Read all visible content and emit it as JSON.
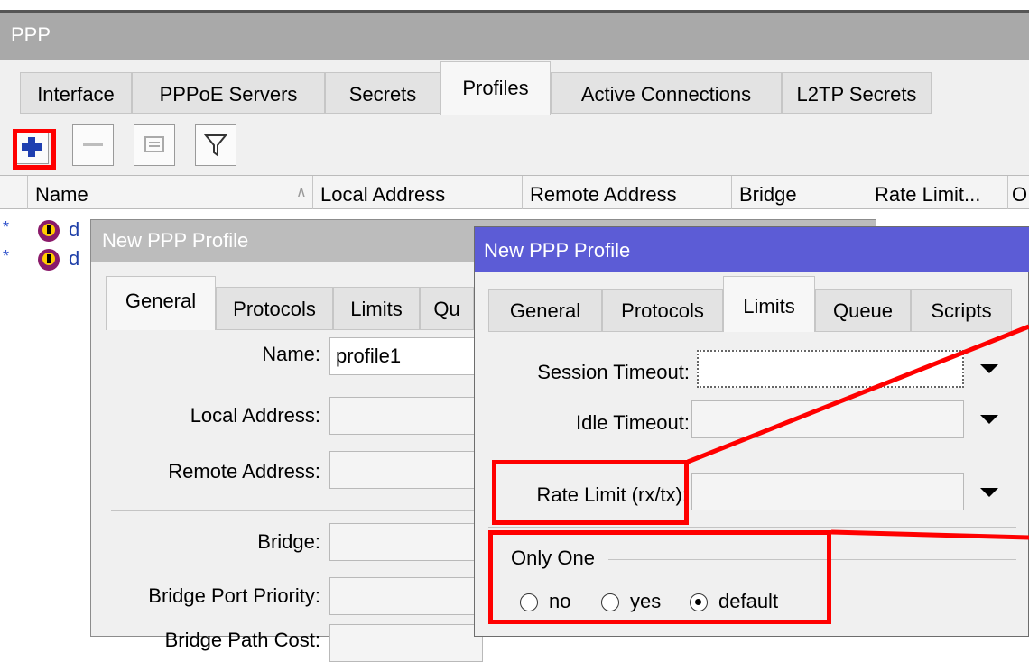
{
  "window": {
    "title": "PPP"
  },
  "main_tabs": [
    {
      "label": "Interface"
    },
    {
      "label": "PPPoE Servers"
    },
    {
      "label": "Secrets"
    },
    {
      "label": "Profiles"
    },
    {
      "label": "Active Connections"
    },
    {
      "label": "L2TP Secrets"
    }
  ],
  "active_main_tab": "Profiles",
  "toolbar": [
    "add-icon",
    "remove-icon",
    "comment-icon",
    "filter-icon"
  ],
  "table": {
    "columns": [
      "Name",
      "Local Address",
      "Remote Address",
      "Bridge",
      "Rate Limit...",
      "O"
    ],
    "rows": [
      {
        "marker": "*",
        "name": "d"
      },
      {
        "marker": "*",
        "name": "d"
      }
    ]
  },
  "dialog_general": {
    "title": "New PPP Profile",
    "tabs": [
      "General",
      "Protocols",
      "Limits",
      "Qu"
    ],
    "active_tab": "General",
    "fields": {
      "name_label": "Name:",
      "name_value": "profile1",
      "local_address_label": "Local Address:",
      "remote_address_label": "Remote Address:",
      "bridge_label": "Bridge:",
      "bridge_port_priority_label": "Bridge Port Priority:",
      "bridge_path_cost_label": "Bridge Path Cost:"
    }
  },
  "dialog_limits": {
    "title": "New PPP Profile",
    "tabs": [
      "General",
      "Protocols",
      "Limits",
      "Queue",
      "Scripts"
    ],
    "active_tab": "Limits",
    "session_timeout_label": "Session Timeout:",
    "idle_timeout_label": "Idle Timeout:",
    "rate_limit_label": "Rate Limit (rx/tx):",
    "only_one": {
      "label": "Only One",
      "options": [
        "no",
        "yes",
        "default"
      ],
      "selected": "default"
    }
  },
  "colors": {
    "annotation": "#ff0000",
    "active_title_bar": "#5c5cd6",
    "inactive_title_bar": "#bcbcbc"
  }
}
